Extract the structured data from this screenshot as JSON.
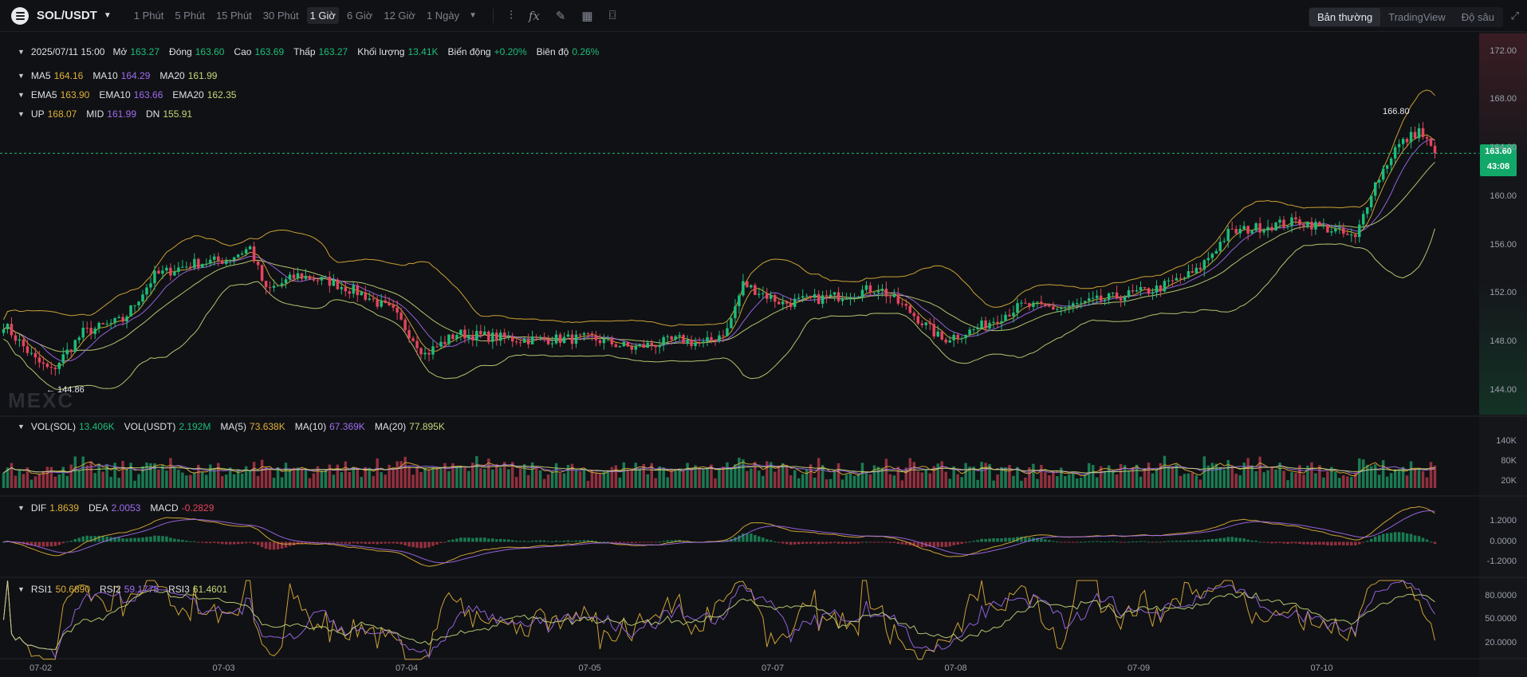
{
  "toolbar": {
    "symbol": "SOL/USDT",
    "timeframes": [
      "1 Phút",
      "5 Phút",
      "15 Phút",
      "30 Phút",
      "1 Giờ",
      "6 Giờ",
      "12 Giờ",
      "1 Ngày"
    ],
    "active_timeframe": "1 Giờ",
    "tool_icons": [
      "candle-type-icon",
      "formula-icon",
      "draw-icon",
      "layout-icon",
      "camera-icon"
    ],
    "modes": [
      "Bản thường",
      "TradingView",
      "Độ sâu"
    ],
    "active_mode": "Bản thường"
  },
  "ohlc": {
    "time": "2025/07/11 15:00",
    "open_label": "Mở",
    "open": "163.27",
    "close_label": "Đóng",
    "close": "163.60",
    "high_label": "Cao",
    "high": "163.69",
    "low_label": "Thấp",
    "low": "163.27",
    "volume_label": "Khối lượng",
    "volume": "13.41K",
    "change_label": "Biến động",
    "change": "+0.20%",
    "amplitude_label": "Biên độ",
    "amplitude": "0.26%"
  },
  "ma": {
    "ma5_label": "MA5",
    "ma5": "164.16",
    "ma10_label": "MA10",
    "ma10": "164.29",
    "ma20_label": "MA20",
    "ma20": "161.99"
  },
  "ema": {
    "ema5_label": "EMA5",
    "ema5": "163.90",
    "ema10_label": "EMA10",
    "ema10": "163.66",
    "ema20_label": "EMA20",
    "ema20": "162.35"
  },
  "boll": {
    "up_label": "UP",
    "up": "168.07",
    "mid_label": "MID",
    "mid": "161.99",
    "dn_label": "DN",
    "dn": "155.91"
  },
  "vol_legend": {
    "vol_sol_label": "VOL(SOL)",
    "vol_sol": "13.406K",
    "vol_usdt_label": "VOL(USDT)",
    "vol_usdt": "2.192M",
    "ma5_label": "MA(5)",
    "ma5": "73.638K",
    "ma10_label": "MA(10)",
    "ma10": "67.369K",
    "ma20_label": "MA(20)",
    "ma20": "77.895K"
  },
  "macd_legend": {
    "dif_label": "DIF",
    "dif": "1.8639",
    "dea_label": "DEA",
    "dea": "2.0053",
    "macd_label": "MACD",
    "macd": "-0.2829"
  },
  "rsi_legend": {
    "rsi1_label": "RSI1",
    "rsi1": "50.6890",
    "rsi2_label": "RSI2",
    "rsi2": "59.1778",
    "rsi3_label": "RSI3",
    "rsi3": "61.4601"
  },
  "watermark": "MEXC",
  "price_tag": {
    "price": "163.60",
    "countdown": "43:08"
  },
  "colors": {
    "up": "#1dbd7a",
    "down": "#e5445d",
    "bg": "#101114",
    "ma5": "#e0b03a",
    "ma10": "#a06cf0",
    "ma20": "#c4d77a"
  },
  "chart_data": {
    "type": "candlestick",
    "symbol": "SOL/USDT",
    "interval": "1h",
    "price_axis": {
      "ticks": [
        172,
        168,
        164,
        160,
        156,
        152,
        148,
        144
      ],
      "labels": [
        "172.00",
        "168.00",
        "164.00",
        "160.00",
        "156.00",
        "152.00",
        "148.00",
        "144.00"
      ],
      "range": [
        142,
        173.5
      ]
    },
    "last_price": 163.6,
    "annotations": {
      "high": {
        "label": "166.80",
        "value": 166.8
      },
      "low": {
        "label": "144.86",
        "value": 144.86
      }
    },
    "x_labels": [
      "07-02",
      "07-03",
      "07-04",
      "07-05",
      "07-07",
      "07-08",
      "07-09",
      "07-10"
    ],
    "close_path_keyframes": [
      {
        "i": 0,
        "p": 149.5
      },
      {
        "i": 8,
        "p": 146.5
      },
      {
        "i": 12,
        "p": 145.6
      },
      {
        "i": 20,
        "p": 148.8
      },
      {
        "i": 30,
        "p": 149.8
      },
      {
        "i": 38,
        "p": 153.5
      },
      {
        "i": 48,
        "p": 154.5
      },
      {
        "i": 56,
        "p": 154.8
      },
      {
        "i": 62,
        "p": 155.8
      },
      {
        "i": 66,
        "p": 152.2
      },
      {
        "i": 74,
        "p": 153.5
      },
      {
        "i": 82,
        "p": 153.0
      },
      {
        "i": 90,
        "p": 152.0
      },
      {
        "i": 98,
        "p": 150.5
      },
      {
        "i": 106,
        "p": 147.0
      },
      {
        "i": 114,
        "p": 148.7
      },
      {
        "i": 130,
        "p": 148.2
      },
      {
        "i": 148,
        "p": 148.3
      },
      {
        "i": 158,
        "p": 147.5
      },
      {
        "i": 170,
        "p": 148.2
      },
      {
        "i": 176,
        "p": 147.8
      },
      {
        "i": 182,
        "p": 149.0
      },
      {
        "i": 186,
        "p": 152.8
      },
      {
        "i": 196,
        "p": 151.2
      },
      {
        "i": 210,
        "p": 151.8
      },
      {
        "i": 220,
        "p": 152.5
      },
      {
        "i": 228,
        "p": 150.5
      },
      {
        "i": 236,
        "p": 148.2
      },
      {
        "i": 244,
        "p": 149.0
      },
      {
        "i": 256,
        "p": 151.0
      },
      {
        "i": 266,
        "p": 150.8
      },
      {
        "i": 278,
        "p": 151.6
      },
      {
        "i": 290,
        "p": 152.4
      },
      {
        "i": 300,
        "p": 153.8
      },
      {
        "i": 308,
        "p": 157.0
      },
      {
        "i": 316,
        "p": 157.5
      },
      {
        "i": 326,
        "p": 158.0
      },
      {
        "i": 334,
        "p": 157.3
      },
      {
        "i": 340,
        "p": 156.5
      },
      {
        "i": 344,
        "p": 160.5
      },
      {
        "i": 350,
        "p": 164.0
      },
      {
        "i": 356,
        "p": 165.5
      },
      {
        "i": 360,
        "p": 163.6
      }
    ],
    "volume_axis": {
      "labels": [
        "140K",
        "80K",
        "20K"
      ],
      "values": [
        140000,
        80000,
        20000
      ]
    },
    "macd_axis": {
      "labels": [
        "1.2000",
        "0.0000",
        "-1.2000"
      ],
      "values": [
        1.2,
        0,
        -1.2
      ]
    },
    "rsi_axis": {
      "labels": [
        "80.0000",
        "50.0000",
        "20.0000"
      ],
      "values": [
        80,
        50,
        20
      ]
    }
  }
}
